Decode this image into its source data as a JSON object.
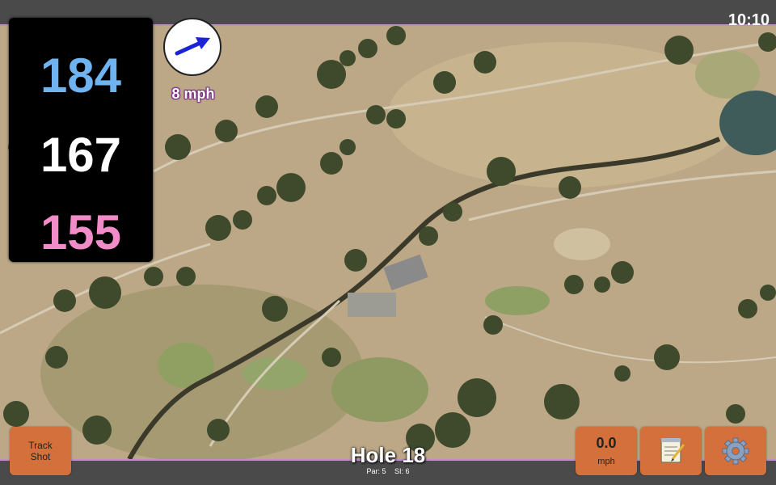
{
  "status": {
    "time": "10:10"
  },
  "distances": {
    "back": "184",
    "middle": "167",
    "front": "155"
  },
  "wind": {
    "speed_label": "8 mph",
    "icon": "wind-direction-arrow-icon"
  },
  "hole": {
    "title": "Hole 18",
    "par": "Par: 5",
    "stroke_index": "SI: 6"
  },
  "buttons": {
    "track_shot_line1": "Track",
    "track_shot_line2": "Shot",
    "speed_value": "0.0",
    "speed_unit": "mph",
    "notes_icon": "notepad-icon",
    "settings_icon": "gear-icon"
  },
  "colors": {
    "back_distance": "#6fb3f0",
    "middle_distance": "#ffffff",
    "front_distance": "#f28cc8",
    "button": "#d4703c",
    "map_border": "#c38bc9"
  }
}
